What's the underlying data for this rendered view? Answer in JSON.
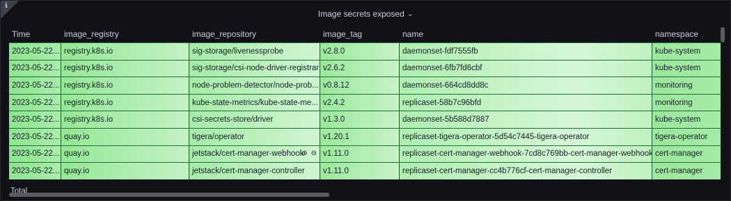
{
  "panel": {
    "title": "Image secrets exposed",
    "chevron": "⌄",
    "info_icon": "ℹ"
  },
  "table": {
    "columns": [
      "Time",
      "image_registry",
      "image_repository",
      "image_tag",
      "name",
      "namespace"
    ],
    "rows": [
      [
        "2023-05-22...",
        "registry.k8s.io",
        "sig-storage/livenessprobe",
        "v2.8.0",
        "daemonset-fdf7555fb",
        "kube-system"
      ],
      [
        "2023-05-22...",
        "registry.k8s.io",
        "sig-storage/csi-node-driver-registrar",
        "v2.6.2",
        "daemonset-6fb7fd6cbf",
        "kube-system"
      ],
      [
        "2023-05-22...",
        "registry.k8s.io",
        "node-problem-detector/node-prob...",
        "v0.8.12",
        "daemonset-664cd8dd8c",
        "monitoring"
      ],
      [
        "2023-05-22...",
        "registry.k8s.io",
        "kube-state-metrics/kube-state-me...",
        "v2.4.2",
        "replicaset-58b7c96bfd",
        "monitoring"
      ],
      [
        "2023-05-22...",
        "registry.k8s.io",
        "csi-secrets-store/driver",
        "v1.3.0",
        "daemonset-5b588d7887",
        "kube-system"
      ],
      [
        "2023-05-22...",
        "quay.io",
        "tigera/operator",
        "v1.20.1",
        "replicaset-tigera-operator-5d54c7445-tigera-operator",
        "tigera-operator"
      ],
      [
        "2023-05-22...",
        "quay.io",
        "jetstack/cert-manager-webhook",
        "v1.11.0",
        "replicaset-cert-manager-webhook-7cd8c769bb-cert-manager-webhook",
        "cert-manager"
      ],
      [
        "2023-05-22...",
        "quay.io",
        "jetstack/cert-manager-controller",
        "v1.11.0",
        "replicaset-cert-manager-cc4b776cf-cert-manager-controller",
        "cert-manager"
      ]
    ],
    "hover_icons": [
      "zoom-in-icon",
      "zoom-out-icon"
    ],
    "footer_label": "Total"
  },
  "colors": {
    "background": "#111217",
    "cell_green": "#a6eba7"
  }
}
